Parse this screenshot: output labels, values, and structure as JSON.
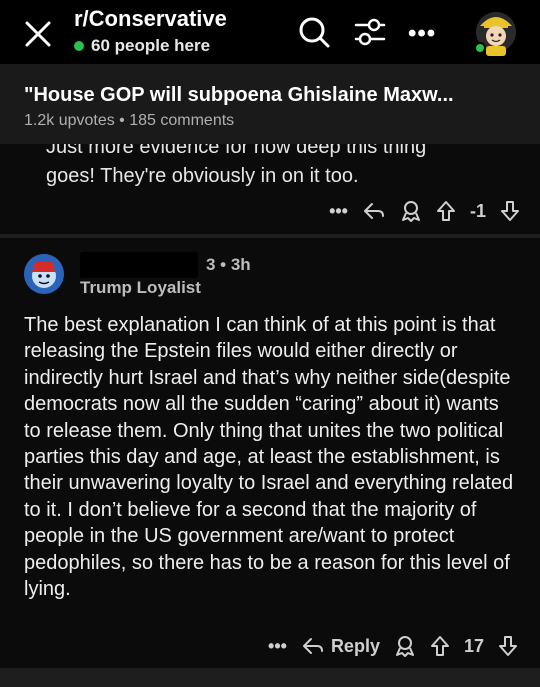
{
  "header": {
    "subreddit": "r/Conservative",
    "online_text": "60 people here",
    "icons": [
      "close-icon",
      "search-icon",
      "filter-icon",
      "more-icon",
      "avatar"
    ]
  },
  "post": {
    "title": "\"House GOP will subpoena Ghislaine Maxw...",
    "meta": "1.2k upvotes • 185 comments"
  },
  "previous_comment": {
    "line1": "Just more evidence for how deep this thing",
    "line2": "goes! They're obviously in on it too.",
    "vote_count": "-1",
    "more": "•••"
  },
  "comment": {
    "time": "3 • 3h",
    "flair": "Trump Loyalist",
    "body": "The best explanation I can think of at this point is that releasing the Epstein files would either directly or indirectly hurt Israel and that’s why neither side(despite democrats now all the sudden “caring” about it) wants to release them. Only thing that unites the two political parties this day and age, at least the establishment, is their unwavering loyalty to Israel and everything related to it. I don’t believe for a second that the majority of people in the US government are/want to protect pedophiles, so there has to be a reason for this level of lying.",
    "reply_label": "Reply",
    "vote_count": "17",
    "more": "•••"
  },
  "colors": {
    "online_dot": "#2bc14b",
    "background": "#000000",
    "card": "#1a1a1b"
  }
}
